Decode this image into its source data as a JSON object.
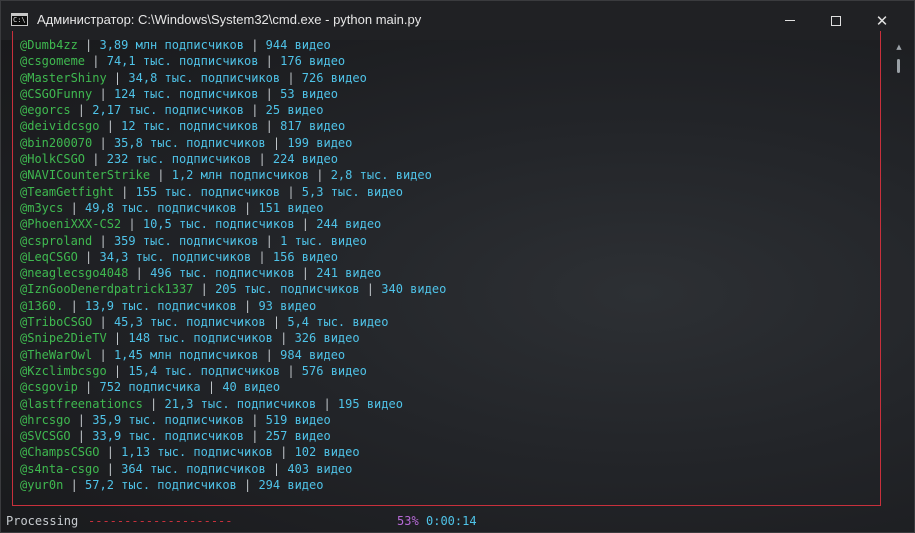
{
  "window": {
    "title": "Администратор: C:\\Windows\\System32\\cmd.exe - python  main.py",
    "icon_text": "C:\\"
  },
  "controls": {
    "minimize": "minimize-icon",
    "maximize": "maximize-icon",
    "close": "✕"
  },
  "separator": " | ",
  "rows": [
    {
      "handle": "@Dumb4zz",
      "subs": "3,89 млн подписчиков",
      "videos": "944 видео"
    },
    {
      "handle": "@csgomeme",
      "subs": "74,1 тыс. подписчиков",
      "videos": "176 видео"
    },
    {
      "handle": "@MasterShiny",
      "subs": "34,8 тыс. подписчиков",
      "videos": "726 видео"
    },
    {
      "handle": "@CSGOFunny",
      "subs": "124 тыс. подписчиков",
      "videos": "53 видео"
    },
    {
      "handle": "@egorcs",
      "subs": "2,17 тыс. подписчиков",
      "videos": "25 видео"
    },
    {
      "handle": "@deividcsgo",
      "subs": "12 тыс. подписчиков",
      "videos": "817 видео"
    },
    {
      "handle": "@bin200070",
      "subs": "35,8 тыс. подписчиков",
      "videos": "199 видео"
    },
    {
      "handle": "@HolkCSGO",
      "subs": "232 тыс. подписчиков",
      "videos": "224 видео"
    },
    {
      "handle": "@NAVICounterStrike",
      "subs": "1,2 млн подписчиков",
      "videos": "2,8 тыс. видео"
    },
    {
      "handle": "@TeamGetfight",
      "subs": "155 тыс. подписчиков",
      "videos": "5,3 тыс. видео"
    },
    {
      "handle": "@m3ycs",
      "subs": "49,8 тыс. подписчиков",
      "videos": "151 видео"
    },
    {
      "handle": "@PhoeniXXX-CS2",
      "subs": "10,5 тыс. подписчиков",
      "videos": "244 видео"
    },
    {
      "handle": "@csproland",
      "subs": "359 тыс. подписчиков",
      "videos": "1 тыс. видео"
    },
    {
      "handle": "@LeqCSGO",
      "subs": "34,3 тыс. подписчиков",
      "videos": "156 видео"
    },
    {
      "handle": "@neaglecsgo4048",
      "subs": "496 тыс. подписчиков",
      "videos": "241 видео"
    },
    {
      "handle": "@IznGooDenerdpatrick1337",
      "subs": "205 тыс. подписчиков",
      "videos": "340 видео"
    },
    {
      "handle": "@1360.",
      "subs": "13,9 тыс. подписчиков",
      "videos": "93 видео"
    },
    {
      "handle": "@TriboCSGO",
      "subs": "45,3 тыс. подписчиков",
      "videos": "5,4 тыс. видео"
    },
    {
      "handle": "@Snipe2DieTV",
      "subs": "148 тыс. подписчиков",
      "videos": "326 видео"
    },
    {
      "handle": "@TheWarOwl",
      "subs": "1,45 млн подписчиков",
      "videos": "984 видео"
    },
    {
      "handle": "@Kzclimbcsgo",
      "subs": "15,4 тыс. подписчиков",
      "videos": "576 видео"
    },
    {
      "handle": "@csgovip",
      "subs": "752 подписчика",
      "videos": "40 видео"
    },
    {
      "handle": "@lastfreenationcs",
      "subs": "21,3 тыс. подписчиков",
      "videos": "195 видео"
    },
    {
      "handle": "@hrcsgo",
      "subs": "35,9 тыс. подписчиков",
      "videos": "519 видео"
    },
    {
      "handle": "@SVCSGO",
      "subs": "33,9 тыс. подписчиков",
      "videos": "257 видео"
    },
    {
      "handle": "@ChampsCSGO",
      "subs": "1,13 тыс. подписчиков",
      "videos": "102 видео"
    },
    {
      "handle": "@s4nta-csgo",
      "subs": "364 тыс. подписчиков",
      "videos": "403 видео"
    },
    {
      "handle": "@yur0n",
      "subs": "57,2 тыс. подписчиков",
      "videos": "294 видео"
    }
  ],
  "status": {
    "label": "Processing",
    "bar": "--------------------",
    "percent": "53%",
    "progress": 0.53,
    "elapsed": "0:00:14"
  },
  "colors": {
    "handle": "#3fb950",
    "numbers": "#4fc3e8",
    "separator": "#bfc4c8",
    "border": "#c8303c",
    "percent": "#b66ad6"
  }
}
